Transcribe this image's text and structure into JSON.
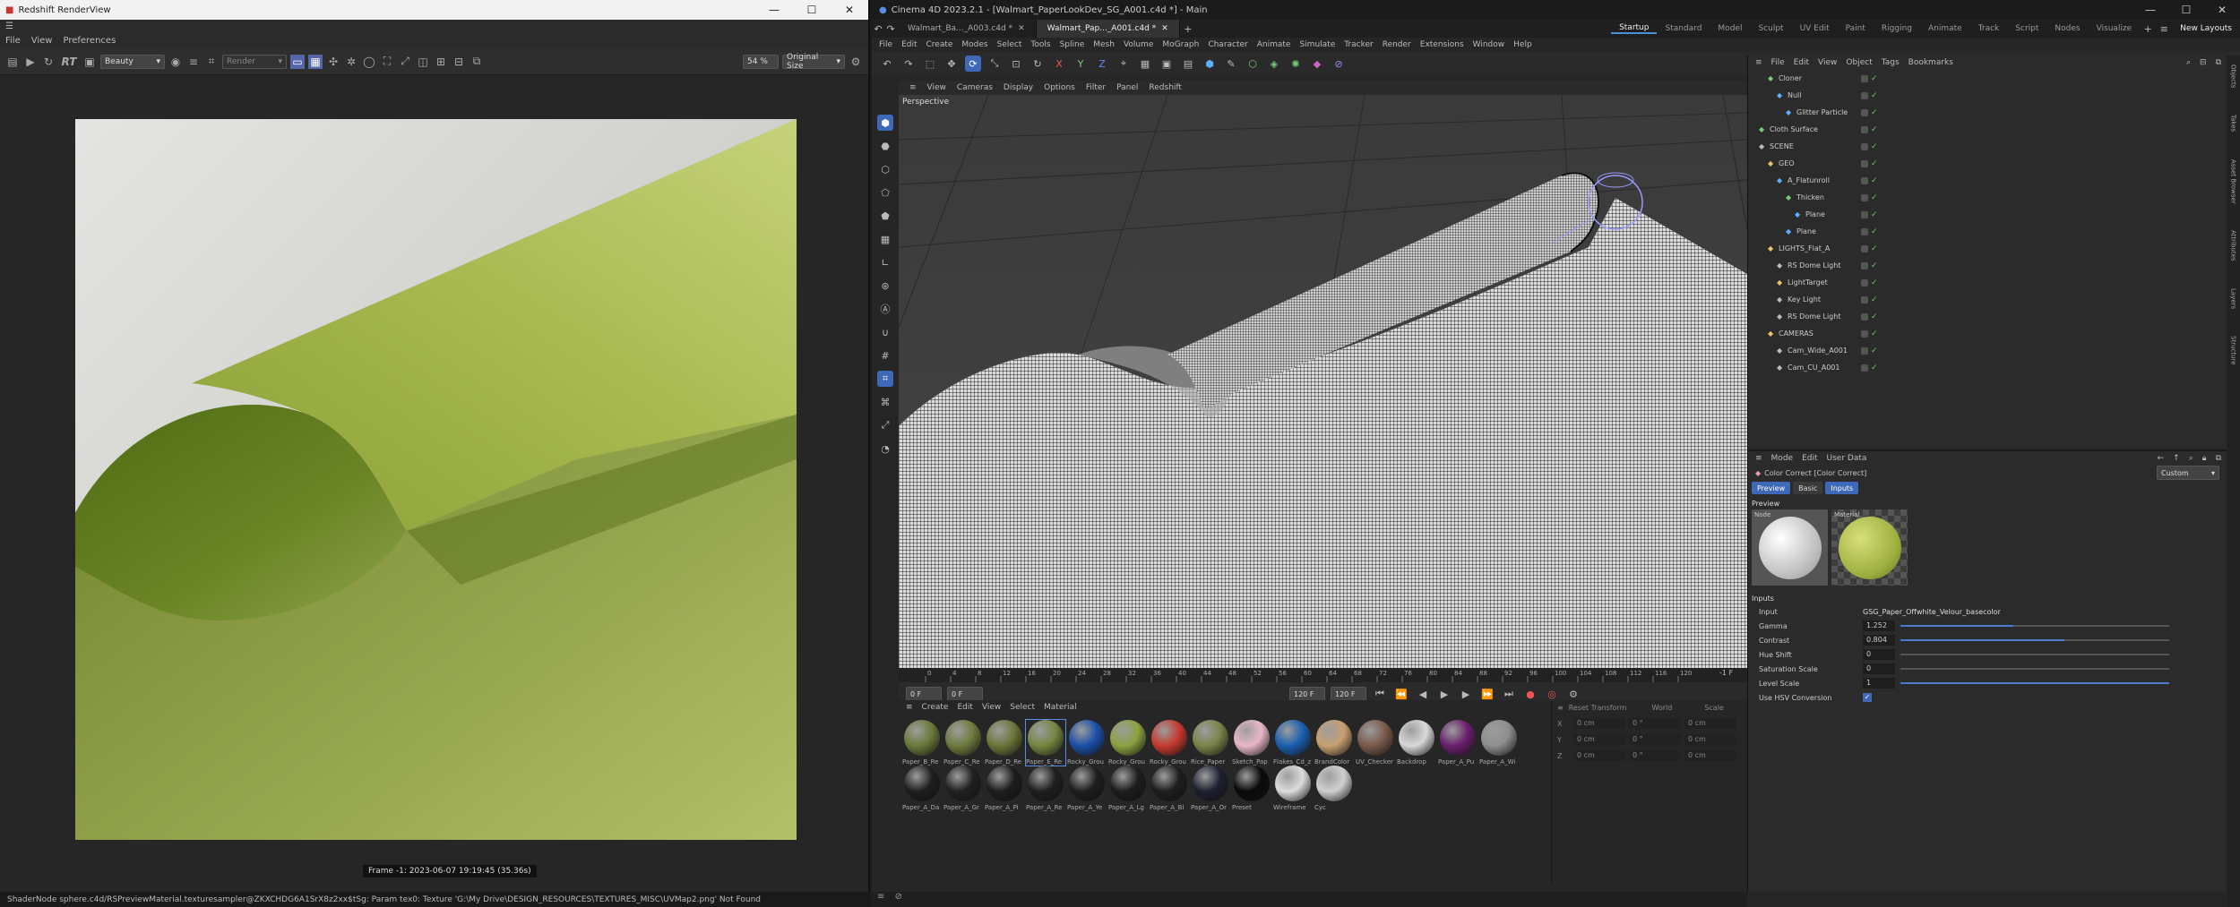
{
  "renderview": {
    "title": "Redshift RenderView",
    "menu": [
      "File",
      "View",
      "Preferences"
    ],
    "rt_label": "RT",
    "aov_select": "Beauty",
    "render_select": "Render",
    "zoom": "54 %",
    "size_select": "Original Size",
    "frame_info": "Frame  -1:  2023-06-07  19:19:45  (35.36s)",
    "status": "ShaderNode sphere.c4d/RSPreviewMaterial.texturesampler@ZKXCHDG6A1SrX8z2xx$tSg: Param tex0: Texture 'G:\\My Drive\\DESIGN_RESOURCES\\TEXTURES_MISC\\UVMap2.png' Not Found"
  },
  "c4d": {
    "title": "Cinema 4D 2023.2.1 - [Walmart_PaperLookDev_SG_A001.c4d *] - Main",
    "doc_tabs": [
      "Walmart_Ba..._A003.c4d *",
      "Walmart_Pap..._A001.c4d *"
    ],
    "layouts": [
      "Startup",
      "Standard",
      "Model",
      "Sculpt",
      "UV Edit",
      "Paint",
      "Rigging",
      "Animate",
      "Track",
      "Script",
      "Nodes",
      "Visualize"
    ],
    "new_layouts": "New Layouts",
    "menu": [
      "File",
      "Edit",
      "Create",
      "Modes",
      "Select",
      "Tools",
      "Spline",
      "Mesh",
      "Volume",
      "MoGraph",
      "Character",
      "Animate",
      "Simulate",
      "Tracker",
      "Render",
      "Extensions",
      "Window",
      "Help"
    ],
    "viewport_menu": [
      "View",
      "Cameras",
      "Display",
      "Options",
      "Filter",
      "Panel",
      "Redshift"
    ],
    "viewport_label": "Perspective",
    "timeline_ticks": [
      "0",
      "4",
      "8",
      "12",
      "16",
      "20",
      "24",
      "28",
      "32",
      "36",
      "40",
      "44",
      "48",
      "52",
      "56",
      "60",
      "64",
      "68",
      "72",
      "76",
      "80",
      "84",
      "88",
      "92",
      "96",
      "100",
      "104",
      "108",
      "112",
      "116",
      "120"
    ],
    "frame_end_label": "-1 F",
    "frame_fields": [
      "0 F",
      "0 F",
      "120 F",
      "120 F"
    ],
    "material_menu": [
      "Create",
      "Edit",
      "View",
      "Select",
      "Material"
    ],
    "materials": [
      {
        "name": "Paper_B_Re",
        "color": "#6b7a3a"
      },
      {
        "name": "Paper_C_Re",
        "color": "#6e7b3c"
      },
      {
        "name": "Paper_D_Re",
        "color": "#6a7638"
      },
      {
        "name": "Paper_E_Re",
        "color": "#748642"
      },
      {
        "name": "Rocky_Grou",
        "color": "#1b4fa8"
      },
      {
        "name": "Rocky_Grou",
        "color": "#8aa23f"
      },
      {
        "name": "Rocky_Grou",
        "color": "#c63a2e"
      },
      {
        "name": "Rice_Paper",
        "color": "#7b8348"
      },
      {
        "name": "Sketch_Pap",
        "color": "#e8b7c8"
      },
      {
        "name": "Flakes_Cd_z",
        "color": "#1b5fb0"
      },
      {
        "name": "BrandColor",
        "color": "#c8a070"
      },
      {
        "name": "UV_Checker",
        "color": "#7a5a4a"
      },
      {
        "name": "Backdrop",
        "color": "#d8d8d8"
      },
      {
        "name": "Paper_A_Pu",
        "color": "#6a1f6e"
      },
      {
        "name": "Paper_A_Wi",
        "color": "#8e8e8e"
      },
      {
        "name": "Paper_A_Da",
        "color": "#1f1f1f"
      },
      {
        "name": "Paper_A_Gr",
        "color": "#202020"
      },
      {
        "name": "Paper_A_Pi",
        "color": "#1d1d1d"
      },
      {
        "name": "Paper_A_Re",
        "color": "#1f1f1f"
      },
      {
        "name": "Paper_A_Ye",
        "color": "#1e1e1e"
      },
      {
        "name": "Paper_A_Lg",
        "color": "#1d1d1d"
      },
      {
        "name": "Paper_A_Bl",
        "color": "#1e1e1e"
      },
      {
        "name": "Paper_A_Or",
        "color": "#1e2030"
      },
      {
        "name": "Preset",
        "color": "#0a0a0a"
      },
      {
        "name": "Wireframe",
        "color": "#dcdcdc"
      },
      {
        "name": "Cyc",
        "color": "#d0d0d0"
      }
    ],
    "coord_headers": [
      "Reset Transform",
      "World",
      "Scale"
    ],
    "coords": [
      {
        "axis": "X",
        "pos": "0 cm",
        "rot": "0 °",
        "scale": "0 cm"
      },
      {
        "axis": "Y",
        "pos": "0 cm",
        "rot": "0 °",
        "scale": "0 cm"
      },
      {
        "axis": "Z",
        "pos": "0 cm",
        "rot": "0 °",
        "scale": "0 cm"
      }
    ],
    "obj_menu": [
      "File",
      "Edit",
      "View",
      "Object",
      "Tags",
      "Bookmarks"
    ],
    "objects": [
      {
        "name": "Cloner",
        "indent": 1
      },
      {
        "name": "Null",
        "indent": 2
      },
      {
        "name": "Glitter Particle",
        "indent": 3
      },
      {
        "name": "Cloth Surface",
        "indent": 0
      },
      {
        "name": "SCENE",
        "indent": 0
      },
      {
        "name": "GEO",
        "indent": 1
      },
      {
        "name": "A_Flatunroll",
        "indent": 2
      },
      {
        "name": "Thicken",
        "indent": 3
      },
      {
        "name": "Plane",
        "indent": 4
      },
      {
        "name": "Plane",
        "indent": 3
      },
      {
        "name": "LIGHTS_Flat_A",
        "indent": 1
      },
      {
        "name": "RS Dome Light",
        "indent": 2
      },
      {
        "name": "LightTarget",
        "indent": 2
      },
      {
        "name": "Key Light",
        "indent": 2
      },
      {
        "name": "RS Dome Light",
        "indent": 2
      },
      {
        "name": "CAMERAS",
        "indent": 1
      },
      {
        "name": "Cam_Wide_A001",
        "indent": 2
      },
      {
        "name": "Cam_CU_A001",
        "indent": 2
      }
    ],
    "attr_menu": [
      "Mode",
      "Edit",
      "User Data"
    ],
    "attr_preset": "Custom",
    "attr_title": "Color Correct [Color Correct]",
    "attr_tabs": [
      "Preview",
      "Basic",
      "Inputs"
    ],
    "preview_header": "Preview",
    "preview_labels": [
      "Node",
      "Material"
    ],
    "inputs_header": "Inputs",
    "inputs": [
      {
        "label": "Input",
        "value": "GSG_Paper_Offwhite_Velour_basecolor",
        "fill": null
      },
      {
        "label": "Gamma",
        "value": "1.252",
        "fill": 0.42
      },
      {
        "label": "Contrast",
        "value": "0.804",
        "fill": 0.61
      },
      {
        "label": "Hue Shift",
        "value": "0",
        "fill": 0
      },
      {
        "label": "Saturation Scale",
        "value": "0",
        "fill": 0
      },
      {
        "label": "Level Scale",
        "value": "1",
        "fill": 1
      },
      {
        "label": "Use HSV Conversion",
        "value": "",
        "fill": null
      }
    ],
    "side_tabs": [
      "Objects",
      "Takes",
      "Asset Browser",
      "Attributes",
      "Layers",
      "Structure"
    ]
  }
}
